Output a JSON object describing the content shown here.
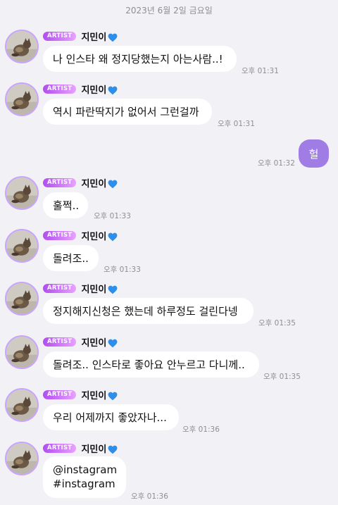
{
  "date_divider": "2023년 6월 2일 금요일",
  "artist_badge": "ARTIST",
  "artist_name": "지민이",
  "accent_color": "#b24cf0",
  "outgoing_bubble_color": "#a07de4",
  "icons": {
    "avatar": "avatar-photo",
    "heart": "blue-heart-icon"
  },
  "messages": [
    {
      "text": "나 인스타 왜 정지당했는지 아는사람..!",
      "time": "오후 01:31"
    },
    {
      "text": "역시 파란딱지가 없어서 그런걸까",
      "time": "오후 01:31"
    },
    {
      "text": "훌쩍..",
      "time": "오후 01:33"
    },
    {
      "text": "돌려조..",
      "time": "오후 01:33"
    },
    {
      "text": "정지해지신청은 했는데 하루정도 걸린다넹",
      "time": "오후 01:35"
    },
    {
      "text": "돌려조.. 인스타로 좋아요 안누르고 다니께..",
      "time": "오후 01:35"
    },
    {
      "text": "우리 어제까지 좋았자나...",
      "time": "오후 01:36"
    },
    {
      "text": "@instagram\n#instagram",
      "time": "오후 01:36"
    }
  ],
  "my_message": {
    "text": "헐",
    "time": "오후 01:32"
  }
}
